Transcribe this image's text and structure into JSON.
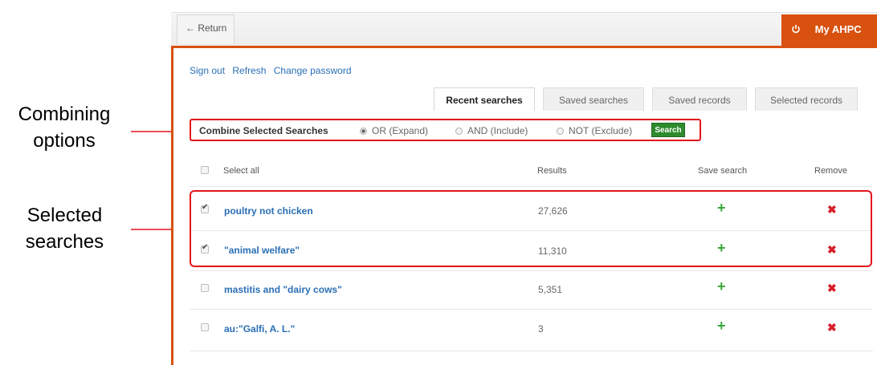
{
  "annotations": {
    "combining": "Combining\noptions",
    "selected": "Selected\nsearches"
  },
  "header": {
    "return_label": "← Return",
    "myahpc_label": "My AHPC",
    "power_icon": "power-icon",
    "accent_color": "#d9510f"
  },
  "account_links": [
    "Sign out",
    "Refresh",
    "Change password"
  ],
  "tabs": [
    {
      "label": "Recent searches",
      "active": true
    },
    {
      "label": "Saved searches",
      "active": false
    },
    {
      "label": "Saved records",
      "active": false
    },
    {
      "label": "Selected records",
      "active": false
    }
  ],
  "combine": {
    "label": "Combine Selected Searches",
    "options": [
      {
        "label": "OR (Expand)",
        "selected": true
      },
      {
        "label": "AND (Include)",
        "selected": false
      },
      {
        "label": "NOT (Exclude)",
        "selected": false
      }
    ],
    "search_button": "Search"
  },
  "table": {
    "headers": {
      "select_all": "Select all",
      "results": "Results",
      "save_search": "Save search",
      "remove": "Remove"
    },
    "rows": [
      {
        "query": "poultry not chicken",
        "results": "27,626",
        "checked": true
      },
      {
        "query": "\"animal welfare\"",
        "results": "11,310",
        "checked": true
      },
      {
        "query": "mastitis and \"dairy cows\"",
        "results": "5,351",
        "checked": false
      },
      {
        "query": "au:\"Galfi, A. L.\"",
        "results": "3",
        "checked": false
      }
    ],
    "save_icon": "plus-icon",
    "remove_icon": "x-icon"
  }
}
